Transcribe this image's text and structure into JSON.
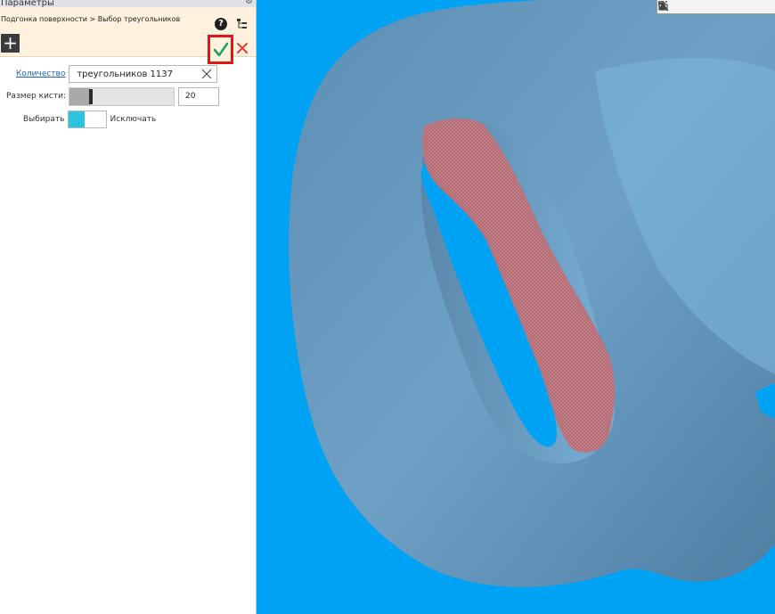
{
  "panel": {
    "title": "Параметры",
    "breadcrumb": "Подгонка поверхности > Выбор треугольников"
  },
  "fields": {
    "count_label": "Количество",
    "count_value": "треугольников 1137",
    "brush_label": "Размер кисти:",
    "brush_value": "20",
    "brush_level_percent": 20,
    "select_label": "Выбирать",
    "exclude_label": "Исключать"
  },
  "colors": {
    "header_bg": "#fef2de",
    "confirm_highlight": "#e0161c",
    "confirm_check": "#21a35a",
    "cancel_x": "#e23b3b",
    "toggle_on": "#29c4e0",
    "viewport_bg": "#00a2f4",
    "model_color": "#6b9ec2",
    "selection_color": "#c07a82"
  },
  "icons": [
    "gear-icon",
    "help-icon",
    "tree-icon",
    "plus-icon",
    "check-icon",
    "close-icon",
    "clear-icon",
    "view-toolbar-icons"
  ]
}
